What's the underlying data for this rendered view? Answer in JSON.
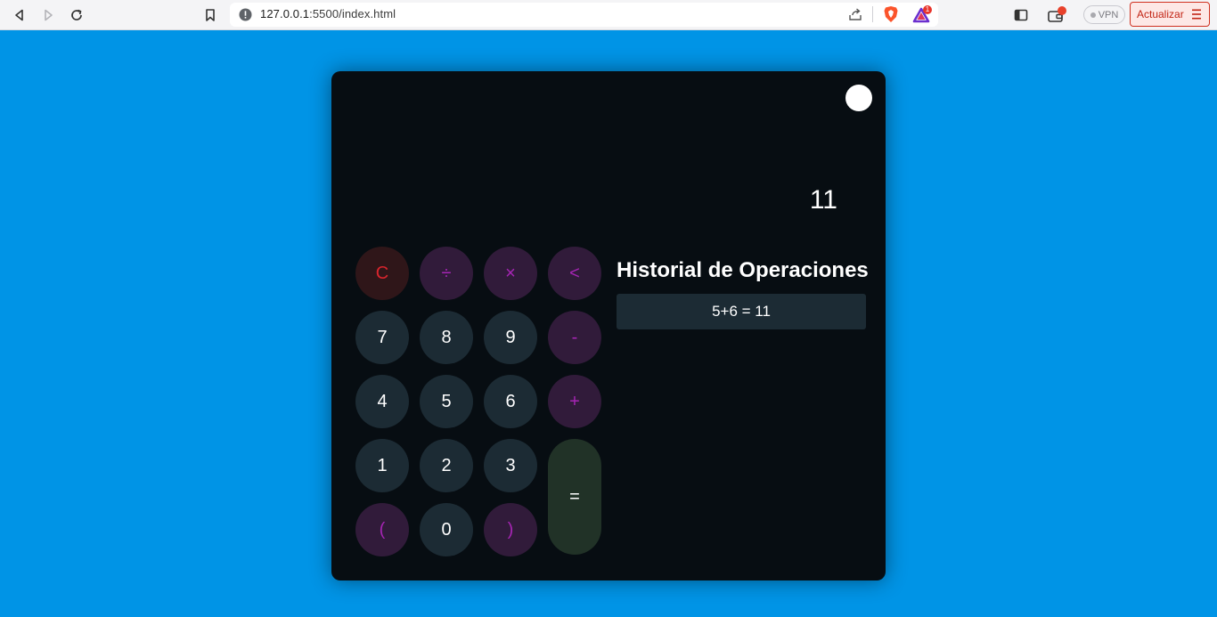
{
  "browser": {
    "url_host": "127.0.0.1",
    "url_rest": ":5500/index.html",
    "vpn_label": "VPN",
    "update_label": "Actualizar",
    "notification_count": "1"
  },
  "calculator": {
    "display_value": "11",
    "keys": {
      "clear": "C",
      "divide": "÷",
      "multiply": "×",
      "backspace": "<",
      "seven": "7",
      "eight": "8",
      "nine": "9",
      "minus": "-",
      "four": "4",
      "five": "5",
      "six": "6",
      "plus": "+",
      "one": "1",
      "two": "2",
      "three": "3",
      "equals": "=",
      "open_paren": "(",
      "zero": "0",
      "close_paren": ")"
    },
    "history": {
      "title": "Historial de Operaciones",
      "items": [
        "5+6 = 11"
      ]
    }
  },
  "colors": {
    "page_background": "#0094e6",
    "calculator_background": "#070d12",
    "number_key": "#1c2b34",
    "operator_key": "#311b3a",
    "operator_text": "#a625b4",
    "clear_key": "#2f1619",
    "clear_text": "#d9252d",
    "equals_key": "#213227"
  }
}
